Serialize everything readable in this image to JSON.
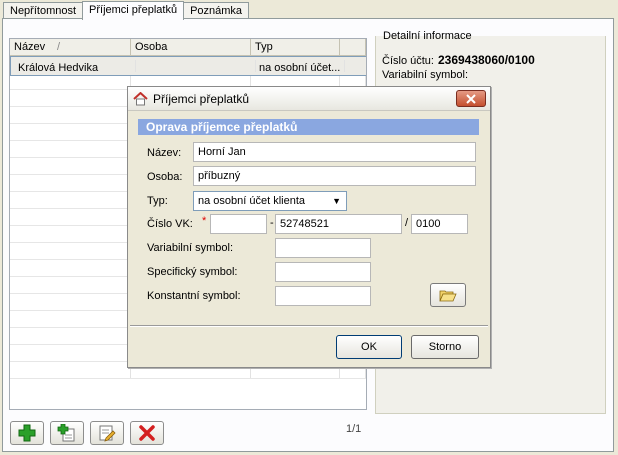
{
  "tabs": [
    {
      "label": "Nepřítomnost",
      "active": false
    },
    {
      "label": "Příjemci přeplatků",
      "active": true
    },
    {
      "label": "Poznámka",
      "active": false
    }
  ],
  "grid": {
    "columns": [
      "Název",
      "Osoba",
      "Typ",
      ""
    ],
    "sort_indicator": "/",
    "rows": [
      {
        "nazev": "Králová Hedvika",
        "osoba": "",
        "typ": "na osobní účet..."
      }
    ]
  },
  "detail": {
    "title": "Detailní informace",
    "cislo_uctu_label": "Číslo účtu:",
    "cislo_uctu_value": "2369438060/0100",
    "variabilni_label": "Variabilní symbol:"
  },
  "pager": "1/1",
  "dialog": {
    "title": "Příjemci přeplatků",
    "header": "Oprava příjemce přeplatků",
    "fields": {
      "nazev_label": "Název:",
      "nazev_value": "Horní Jan",
      "osoba_label": "Osoba:",
      "osoba_value": "příbuzný",
      "typ_label": "Typ:",
      "typ_value": "na osobní účet klienta",
      "cislo_vk_label": "Číslo VK:",
      "vk_prefix": "",
      "vk_sep1": "-",
      "vk_number": "52748521",
      "vk_sep2": "/",
      "vk_bank": "0100",
      "variabilni_label": "Variabilní symbol:",
      "variabilni_value": "",
      "specificky_label": "Specifický symbol:",
      "specificky_value": "",
      "konstantni_label": "Konstantní symbol:",
      "konstantni_value": ""
    },
    "required_mark": "*",
    "ok_label": "OK",
    "storno_label": "Storno"
  },
  "colors": {
    "dialog_header_bg": "#8aa7e0",
    "close_button": "#c4502f",
    "add_green": "#2aa02a",
    "delete_red": "#d42020"
  },
  "icons": [
    "plus-icon",
    "add-plus-icon",
    "edit-icon",
    "delete-x-icon",
    "folder-open-icon",
    "home-icon",
    "close-icon",
    "chevron-down-icon"
  ]
}
